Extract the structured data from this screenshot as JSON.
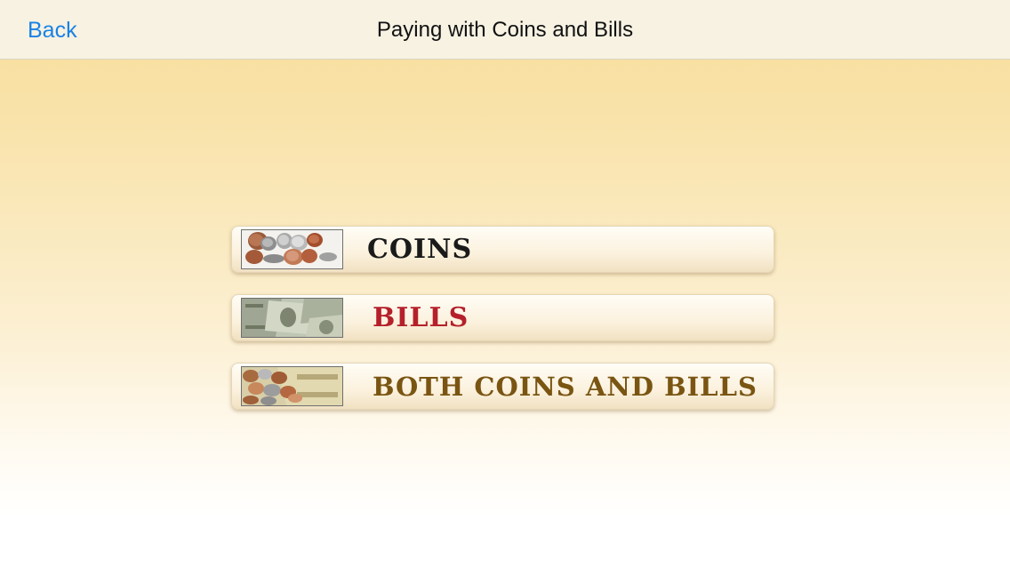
{
  "navbar": {
    "back_label": "Back",
    "title": "Paying with Coins and Bills"
  },
  "menu": {
    "items": [
      {
        "label": "COINS",
        "thumbnail": "coins-image",
        "color": "#1a1a1a"
      },
      {
        "label": "BILLS",
        "thumbnail": "bills-image",
        "color": "#b5202b"
      },
      {
        "label": "BOTH COINS AND BILLS",
        "thumbnail": "coins-and-bills-image",
        "color": "#7a5512"
      }
    ]
  },
  "colors": {
    "accent": "#1a82e6",
    "navbar_bg": "#f7f2e2"
  }
}
